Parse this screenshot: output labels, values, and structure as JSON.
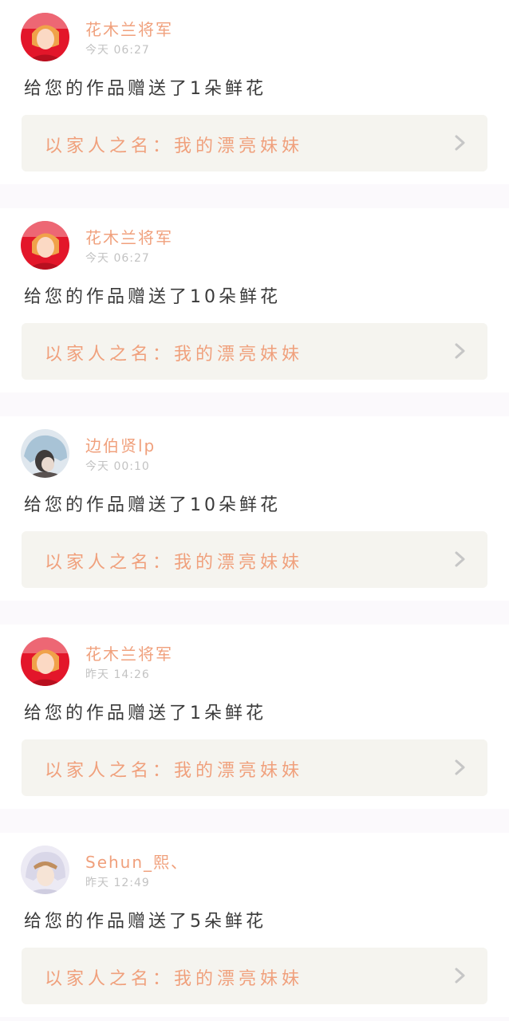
{
  "feed": {
    "items": [
      {
        "username": "花木兰将军",
        "time": "今天 06:27",
        "message": "给您的作品赠送了1朵鲜花",
        "dedication": "以家人之名：我的漂亮妹妹",
        "avatar": "red-portrait"
      },
      {
        "username": "花木兰将军",
        "time": "今天 06:27",
        "message": "给您的作品赠送了10朵鲜花",
        "dedication": "以家人之名：我的漂亮妹妹",
        "avatar": "red-portrait"
      },
      {
        "username": "边伯贤lp",
        "time": "今天 00:10",
        "message": "给您的作品赠送了10朵鲜花",
        "dedication": "以家人之名：我的漂亮妹妹",
        "avatar": "blue-hood-portrait"
      },
      {
        "username": "花木兰将军",
        "time": "昨天 14:26",
        "message": "给您的作品赠送了1朵鲜花",
        "dedication": "以家人之名：我的漂亮妹妹",
        "avatar": "red-portrait"
      },
      {
        "username": "Sehun_熙、",
        "time": "昨天 12:49",
        "message": "给您的作品赠送了5朵鲜花",
        "dedication": "以家人之名：我的漂亮妹妹",
        "avatar": "pale-hood-portrait"
      }
    ]
  },
  "icons": {
    "chevron": "chevron-right-icon"
  },
  "colors": {
    "username": "#f0a07c",
    "dedication_text": "#f0a07c",
    "timestamp": "#c3c3c3",
    "message": "#3a3a3a",
    "dedication_bg": "#f5f4ef",
    "separator": "#fbf9fc"
  }
}
